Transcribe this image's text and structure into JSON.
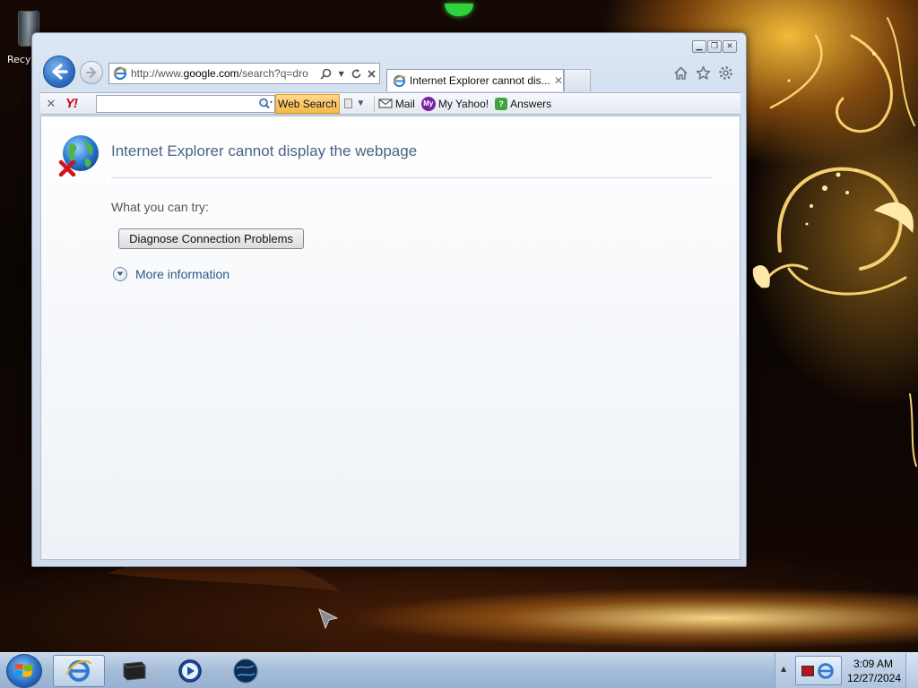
{
  "desktop": {
    "icons": [
      {
        "label": "Recy"
      }
    ]
  },
  "browser": {
    "address_url_prefix": "http://www.",
    "address_url_domain": "google.com",
    "address_url_rest": "/search?q=dro",
    "active_tab_title": "Internet Explorer cannot dis...",
    "tab_close_glyph": "✕",
    "icons": {
      "back": "back-arrow-icon",
      "forward": "forward-arrow-icon",
      "search": "search-icon",
      "refresh": "refresh-icon",
      "stop": "stop-icon",
      "home": "home-icon",
      "favorites": "star-icon",
      "tools": "gear-icon"
    }
  },
  "yahoo_toolbar": {
    "logo_text": "Y!",
    "search_value": "",
    "web_search_label": "Web Search",
    "links": [
      {
        "label": "Mail",
        "icon": "mail-icon"
      },
      {
        "label": "My Yahoo!",
        "icon": "my-yahoo-icon",
        "badge": "My"
      },
      {
        "label": "Answers",
        "icon": "answers-icon"
      }
    ]
  },
  "page": {
    "title": "Internet Explorer cannot display the webpage",
    "try_label": "What you can try:",
    "diagnose_button": "Diagnose Connection Problems",
    "more_info": "More information"
  },
  "taskbar": {
    "time": "3:09 AM",
    "date": "12/27/2024",
    "pinned": [
      "internet-explorer-icon",
      "media-center-icon",
      "media-player-icon",
      "globe-app-icon"
    ]
  },
  "colors": {
    "title_text": "#4a6383",
    "link_text": "#2e5a8a",
    "web_search_button": "#f6b84a",
    "yahoo_red": "#d4001f"
  }
}
